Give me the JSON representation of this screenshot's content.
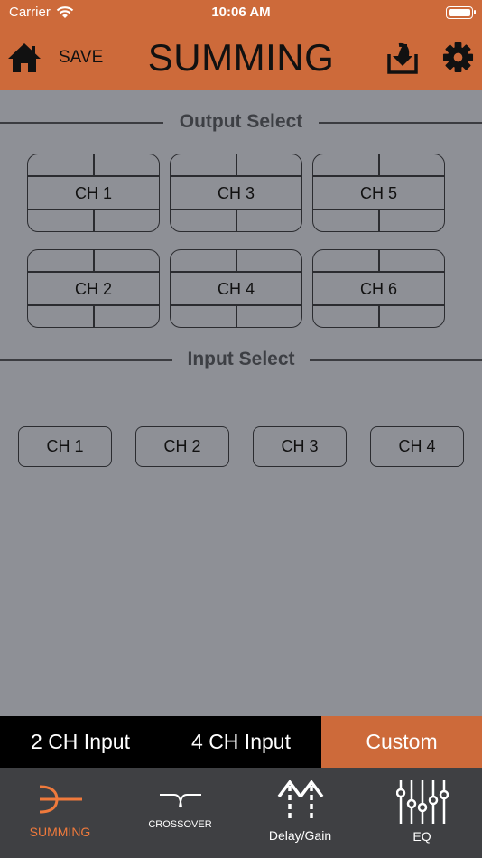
{
  "status": {
    "carrier": "Carrier",
    "time": "10:06 AM"
  },
  "header": {
    "save_label": "SAVE",
    "title": "SUMMING",
    "icons": [
      "home-icon",
      "export-icon",
      "gear-icon"
    ]
  },
  "output_select": {
    "heading": "Output Select",
    "channels": [
      "CH 1",
      "CH 3",
      "CH 5",
      "CH 2",
      "CH 4",
      "CH 6"
    ]
  },
  "input_select": {
    "heading": "Input Select",
    "channels": [
      "CH 1",
      "CH 2",
      "CH 3",
      "CH 4"
    ]
  },
  "modes": {
    "items": [
      "2 CH Input",
      "4 CH Input",
      "Custom"
    ],
    "selected": "Custom"
  },
  "tabs": [
    {
      "label": "SUMMING",
      "icon": "summing-icon",
      "active": true
    },
    {
      "label": "CROSSOVER",
      "icon": "crossover-icon",
      "active": false
    },
    {
      "label": "Delay/Gain",
      "icon": "delay-gain-icon",
      "active": false
    },
    {
      "label": "EQ",
      "icon": "eq-icon",
      "active": false
    }
  ],
  "colors": {
    "accent": "#cd6a3a",
    "background": "#8e9096",
    "tabbar": "#3f4043",
    "modebar": "#000000",
    "active_tab_text": "#f07a3c"
  }
}
